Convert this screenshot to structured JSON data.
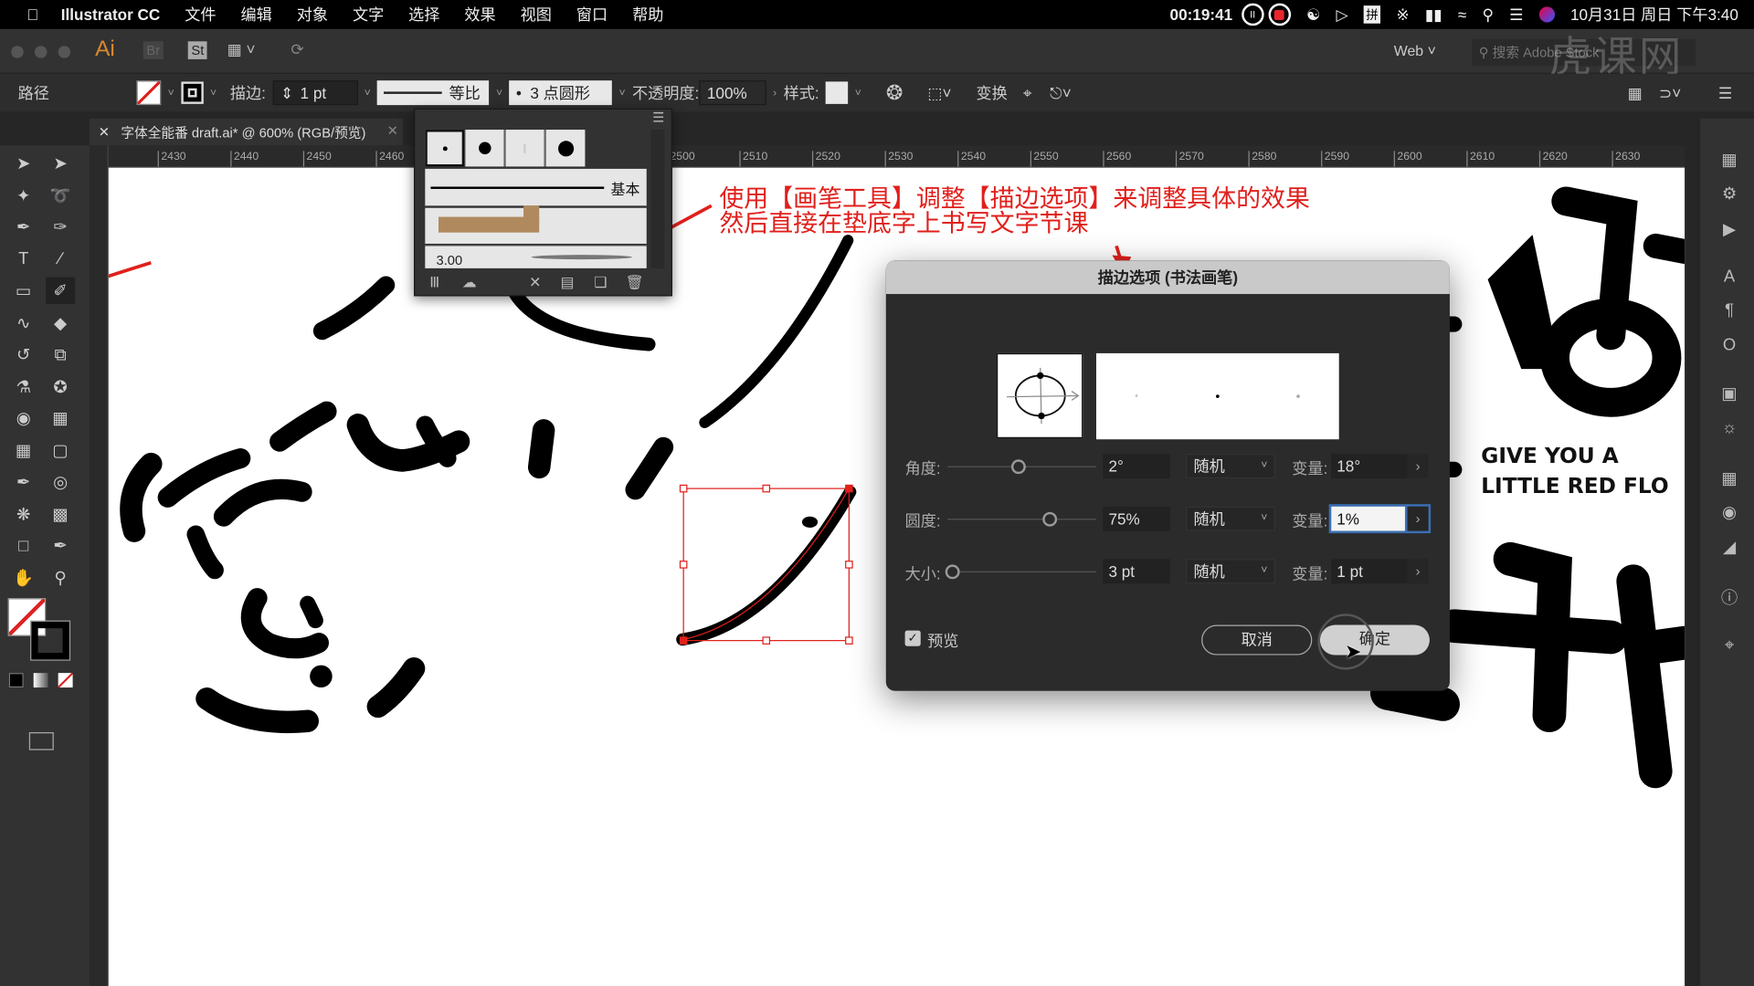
{
  "menubar": {
    "app_name": "Illustrator CC",
    "items": [
      "文件",
      "编辑",
      "对象",
      "文字",
      "选择",
      "效果",
      "视图",
      "窗口",
      "帮助"
    ],
    "timer": "00:19:41",
    "input_method": "拼",
    "clock": "10月31日 周日 下午3:40"
  },
  "appbar": {
    "logo": "Ai",
    "bridge": "Br",
    "stock": "St",
    "workspace": "Web",
    "search_placeholder": "搜索 Adobe Stock",
    "watermark": "虎课网"
  },
  "control": {
    "selection_type": "路径",
    "stroke_label": "描边:",
    "stroke_weight": "1 pt",
    "profile": "等比",
    "brush": "3 点圆形",
    "opacity_label": "不透明度:",
    "opacity": "100%",
    "style_label": "样式:",
    "transform": "变换"
  },
  "document": {
    "tab_title": "字体全能番 draft.ai* @ 600% (RGB/预览)",
    "ruler_labels": [
      "2430",
      "2440",
      "2450",
      "2460",
      "2500",
      "2510",
      "2520",
      "2530",
      "2540",
      "2550",
      "2560",
      "2570",
      "2580",
      "2590",
      "2600",
      "2610",
      "2620",
      "2630"
    ]
  },
  "brush_panel": {
    "basic_label": "基本",
    "size_value": "3.00"
  },
  "annotation": {
    "line1": "使用【画笔工具】调整【描边选项】来调整具体的效果",
    "line2": "然后直接在垫底字上书写文字节课",
    "color": "#e0201c"
  },
  "artwork": {
    "text_line1": "GIVE YOU A",
    "text_line2": "LITTLE RED FLO"
  },
  "dialog": {
    "title": "描边选项 (书法画笔)",
    "rows": [
      {
        "label": "角度:",
        "value": "2°",
        "mode": "随机",
        "var_label": "变量:",
        "variation": "18°",
        "slider_fraction": 0.5
      },
      {
        "label": "圆度:",
        "value": "75%",
        "mode": "随机",
        "var_label": "变量:",
        "variation": "1%",
        "slider_fraction": 0.72
      },
      {
        "label": "大小:",
        "value": "3 pt",
        "mode": "随机",
        "var_label": "变量:",
        "variation": "1 pt",
        "slider_fraction": 0.03
      }
    ],
    "preview_label": "预览",
    "preview_checked": true,
    "cancel": "取消",
    "ok": "确定"
  }
}
